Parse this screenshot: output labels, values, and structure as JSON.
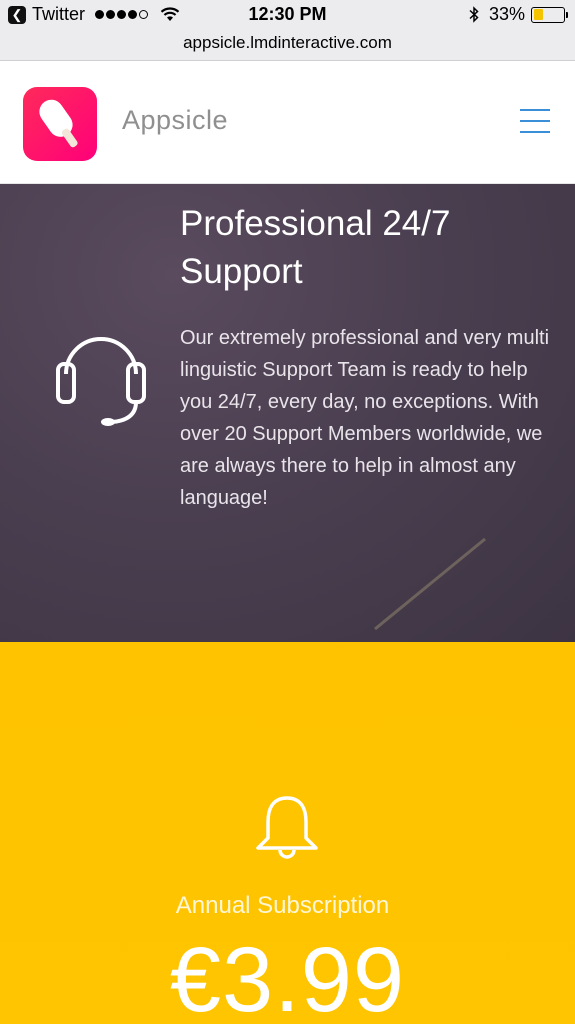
{
  "status_bar": {
    "back_app": "Twitter",
    "time": "12:30 PM",
    "battery": "33%",
    "battery_level": 0.33
  },
  "browser": {
    "url": "appsicle.lmdinteractive.com"
  },
  "header": {
    "brand": "Appsicle"
  },
  "support": {
    "title": "Professional 24/7 Support",
    "body": "Our extremely professional and very multi linguistic Support Team is ready to help you 24/7, every day, no exceptions. With over 20 Support Members worldwide, we are always there to help in almost any language!"
  },
  "subscription": {
    "label": "Annual Subscription",
    "price": "€3.99"
  },
  "icons": {
    "back": "back-icon",
    "wifi": "wifi-icon",
    "bluetooth": "bluetooth-icon",
    "battery": "battery-icon",
    "logo": "popsicle-logo-icon",
    "menu": "hamburger-menu-icon",
    "support": "headset-icon",
    "subscription": "bell-icon"
  },
  "colors": {
    "logo": "#ff1f6b",
    "menu": "#3b8fd9",
    "support_bg": "#4a3f50",
    "subscription_bg": "#ffc300",
    "battery_fill": "#f5c400"
  }
}
